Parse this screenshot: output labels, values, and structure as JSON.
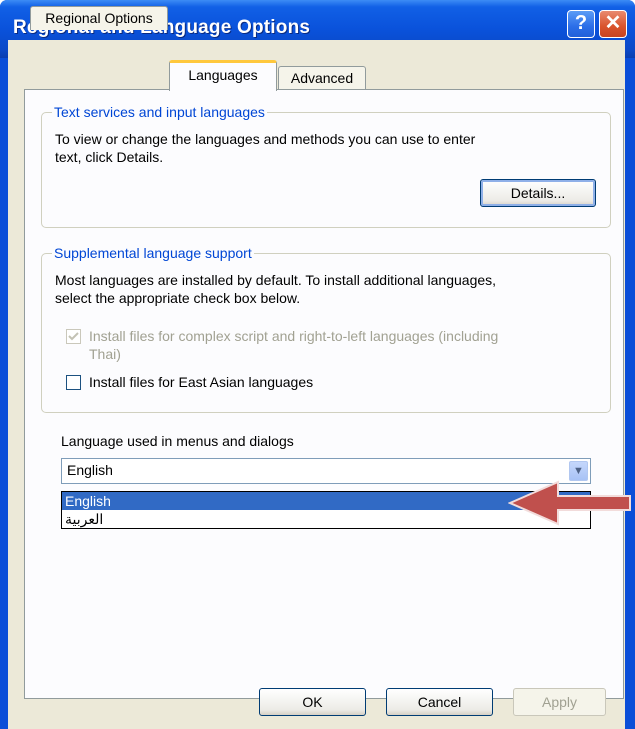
{
  "window": {
    "title": "Regional and Language Options"
  },
  "title_buttons": {
    "help": "?",
    "close": "✕"
  },
  "tabs": [
    {
      "label": "Regional Options"
    },
    {
      "label": "Languages"
    },
    {
      "label": "Advanced"
    }
  ],
  "text_services": {
    "title": "Text services and input languages",
    "description_line1": "To view or change the languages and methods you can use to enter",
    "description_line2": "text, click Details.",
    "details_button": "Details..."
  },
  "supplemental": {
    "title": "Supplemental language support",
    "description_line1": "Most languages are installed by default. To install additional languages,",
    "description_line2": "select the appropriate check box below.",
    "complex_script_line1": "Install files for complex script and right-to-left languages (including",
    "complex_script_line2": "Thai)",
    "complex_script_checked": true,
    "complex_script_disabled": true,
    "east_asian_label": "Install files for East Asian languages",
    "east_asian_checked": false
  },
  "menu_language": {
    "label": "Language used in menus and dialogs",
    "selected": "English",
    "options": [
      "English",
      "العربية"
    ],
    "highlighted_option": "English"
  },
  "annotation": {
    "arrow_color": "#c0504d"
  },
  "buttons": {
    "ok": "OK",
    "cancel": "Cancel",
    "apply": "Apply"
  }
}
